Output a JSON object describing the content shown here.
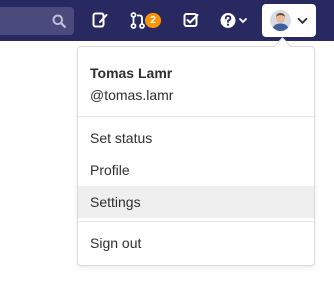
{
  "navbar": {
    "background": "#292961",
    "merge_requests_count": "2",
    "badge_color": "#fc9403",
    "icons": [
      "search-icon",
      "issues-icon",
      "merge-request-icon",
      "todos-icon",
      "help-icon",
      "chevron-down-icon",
      "avatar"
    ]
  },
  "user_menu": {
    "name": "Tomas Lamr",
    "username": "@tomas.lamr",
    "items": [
      {
        "label": "Set status"
      },
      {
        "label": "Profile"
      },
      {
        "label": "Settings",
        "highlighted": true
      },
      {
        "label": "Sign out"
      }
    ]
  }
}
